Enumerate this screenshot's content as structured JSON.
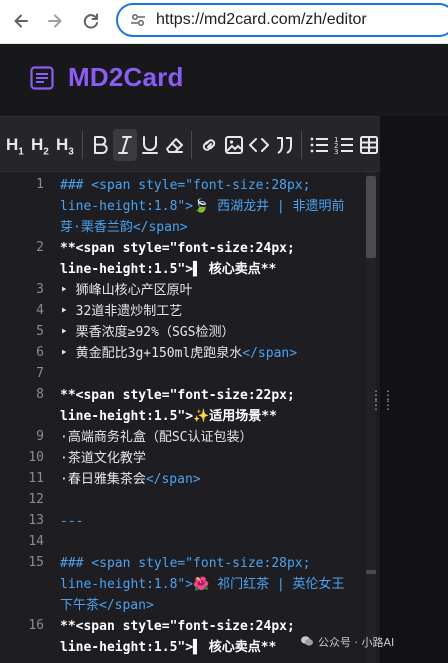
{
  "browser": {
    "url": "https://md2card.com/zh/editor"
  },
  "app": {
    "brand": "MD2Card"
  },
  "toolbar": {
    "h1": "H",
    "h1_sub": "1",
    "h2": "H",
    "h2_sub": "2",
    "h3": "H",
    "h3_sub": "3",
    "buttons": [
      "bold-icon",
      "italic-icon",
      "underline-icon",
      "eraser-icon",
      "link-icon",
      "image-icon",
      "code-icon",
      "quote-icon",
      "bullet-list-icon",
      "numbered-list-icon",
      "table-icon"
    ]
  },
  "editor": {
    "lines": [
      {
        "num": "1",
        "parts": [
          {
            "c": "c-md",
            "t": "### <span style=\"font-size:28px;"
          }
        ]
      },
      {
        "num": "",
        "parts": [
          {
            "c": "c-md",
            "t": "line-height:1.8\">🍃 西湖龙井 | 非遗明前"
          }
        ]
      },
      {
        "num": "",
        "parts": [
          {
            "c": "c-md",
            "t": "芽·栗香兰韵</span>"
          }
        ]
      },
      {
        "num": "2",
        "parts": [
          {
            "c": "c-bold",
            "t": "**<span style=\"font-size:24px;"
          }
        ]
      },
      {
        "num": "",
        "parts": [
          {
            "c": "c-bold",
            "t": "line-height:1.5\">▌ 核心卖点**"
          }
        ]
      },
      {
        "num": "3",
        "parts": [
          {
            "c": "c-text",
            "t": "‣ 狮峰山核心产区原叶"
          }
        ]
      },
      {
        "num": "4",
        "parts": [
          {
            "c": "c-text",
            "t": "‣ 32道非遗炒制工艺"
          }
        ]
      },
      {
        "num": "5",
        "parts": [
          {
            "c": "c-text",
            "t": "‣ 栗香浓度≥92%（SGS检测）"
          }
        ]
      },
      {
        "num": "6",
        "parts": [
          {
            "c": "c-text",
            "t": "‣ 黄金配比3g+150ml虎跑泉水"
          },
          {
            "c": "c-md",
            "t": "</span>"
          }
        ]
      },
      {
        "num": "7",
        "parts": [
          {
            "c": "c-text",
            "t": ""
          }
        ]
      },
      {
        "num": "8",
        "parts": [
          {
            "c": "c-bold",
            "t": "**<span style=\"font-size:22px;"
          }
        ]
      },
      {
        "num": "",
        "parts": [
          {
            "c": "c-bold",
            "t": "line-height:1.5\">✨适用场景**"
          }
        ]
      },
      {
        "num": "9",
        "parts": [
          {
            "c": "c-text",
            "t": "·高端商务礼盒（配SC认证包装）"
          }
        ]
      },
      {
        "num": "10",
        "parts": [
          {
            "c": "c-text",
            "t": "·茶道文化教学"
          }
        ]
      },
      {
        "num": "11",
        "parts": [
          {
            "c": "c-text",
            "t": "·春日雅集茶会"
          },
          {
            "c": "c-md",
            "t": "</span>"
          }
        ]
      },
      {
        "num": "12",
        "parts": [
          {
            "c": "c-text",
            "t": ""
          }
        ]
      },
      {
        "num": "13",
        "parts": [
          {
            "c": "c-md",
            "t": "---"
          }
        ]
      },
      {
        "num": "14",
        "parts": [
          {
            "c": "c-text",
            "t": ""
          }
        ]
      },
      {
        "num": "15",
        "parts": [
          {
            "c": "c-md",
            "t": "### <span style=\"font-size:28px;"
          }
        ]
      },
      {
        "num": "",
        "parts": [
          {
            "c": "c-md",
            "t": "line-height:1.8\">🌺 祁门红茶 | 英伦女王"
          }
        ]
      },
      {
        "num": "",
        "parts": [
          {
            "c": "c-md",
            "t": "下午茶</span>"
          }
        ]
      },
      {
        "num": "16",
        "parts": [
          {
            "c": "c-bold",
            "t": "**<span style=\"font-size:24px;"
          }
        ]
      },
      {
        "num": "",
        "parts": [
          {
            "c": "c-bold",
            "t": "line-height:1.5\">▌ 核心卖点**"
          }
        ]
      }
    ]
  },
  "watermark": {
    "text": "公众号 · 小路AI"
  }
}
